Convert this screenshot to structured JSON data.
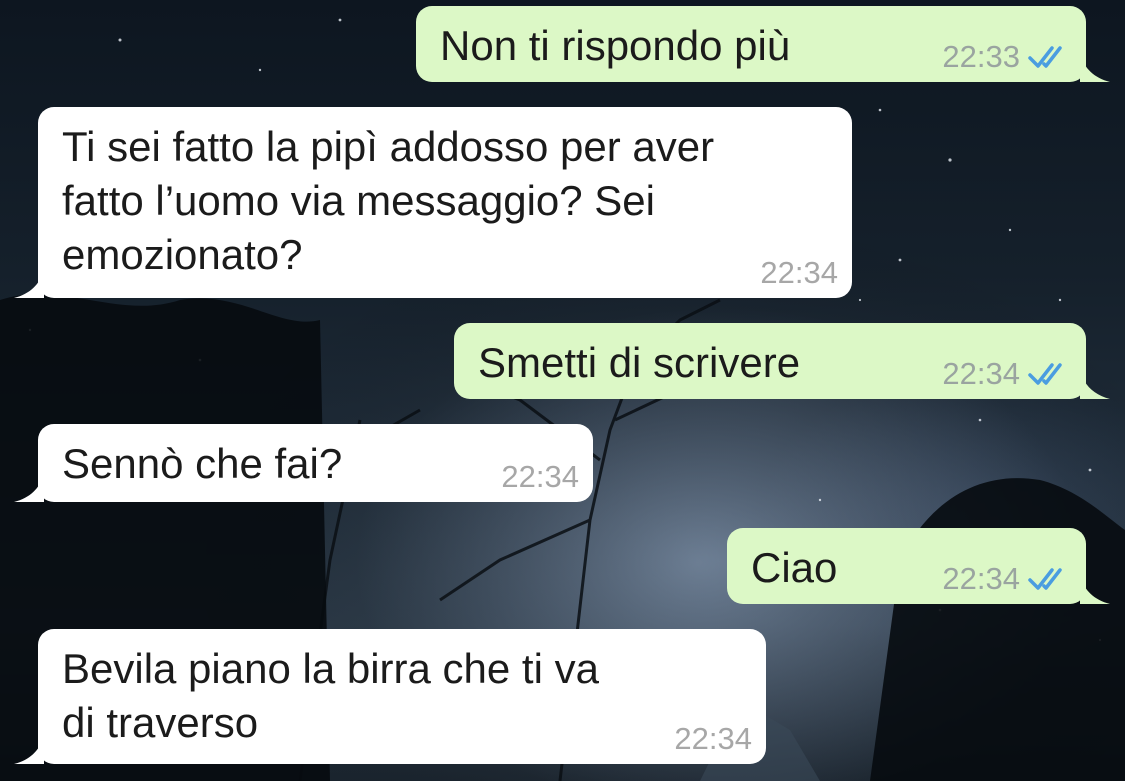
{
  "messages": [
    {
      "direction": "outgoing",
      "text": "Non ti rispondo più",
      "time": "22:33",
      "status": "read-double-check"
    },
    {
      "direction": "incoming",
      "text": "Ti sei fatto la pipì addosso per aver\nfatto l’uomo via messaggio? Sei\nemozionato?",
      "time": "22:34"
    },
    {
      "direction": "outgoing",
      "text": "Smetti di scrivere",
      "time": "22:34",
      "status": "read-double-check"
    },
    {
      "direction": "incoming",
      "text": "Sennò che fai?",
      "time": "22:34"
    },
    {
      "direction": "outgoing",
      "text": "Ciao",
      "time": "22:34",
      "status": "read-double-check"
    },
    {
      "direction": "incoming",
      "text": "Bevila piano la birra che ti va\ndi traverso",
      "time": "22:34"
    }
  ],
  "colors": {
    "outgoing_bubble": "#dcf8c6",
    "incoming_bubble": "#ffffff",
    "read_check": "#4a9de0"
  },
  "icons": {
    "status": "double-check-icon",
    "background": "night-sky-wallpaper"
  }
}
